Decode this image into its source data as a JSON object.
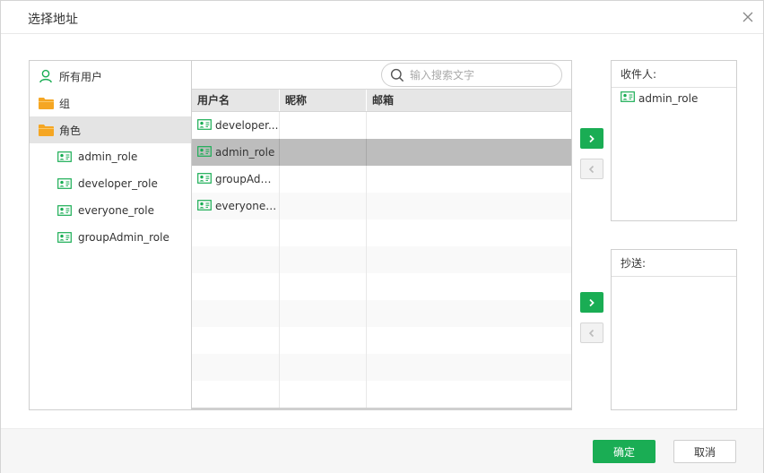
{
  "dialog": {
    "title": "选择地址"
  },
  "tree": {
    "items": [
      {
        "label": "所有用户",
        "icon": "user-icon"
      },
      {
        "label": "组",
        "icon": "folder-icon"
      },
      {
        "label": "角色",
        "icon": "folder-icon",
        "selected": true
      },
      {
        "label": "admin_role",
        "icon": "role-card-icon"
      },
      {
        "label": "developer_role",
        "icon": "role-card-icon"
      },
      {
        "label": "everyone_role",
        "icon": "role-card-icon"
      },
      {
        "label": "groupAdmin_role",
        "icon": "role-card-icon"
      }
    ]
  },
  "search": {
    "placeholder": "输入搜索文字",
    "value": ""
  },
  "grid": {
    "columns": [
      "用户名",
      "昵称",
      "邮箱"
    ],
    "rows": [
      {
        "name": "developer_role",
        "display": "developer...",
        "nickname": "",
        "email": ""
      },
      {
        "name": "admin_role",
        "display": "admin_role",
        "nickname": "",
        "email": "",
        "selected": true
      },
      {
        "name": "groupAdmin_role",
        "display": "groupAdm...",
        "nickname": "",
        "email": ""
      },
      {
        "name": "everyone_role",
        "display": "everyone_...",
        "nickname": "",
        "email": ""
      }
    ]
  },
  "recipients": {
    "to": {
      "label": "收件人:",
      "items": [
        "admin_role"
      ]
    },
    "cc": {
      "label": "抄送:",
      "items": []
    }
  },
  "footer": {
    "ok_label": "确定",
    "cancel_label": "取消"
  },
  "colors": {
    "accent": "#1aad54",
    "folder": "#f5a623",
    "selected_row": "#bdbdbd",
    "selected_tree": "#e4e4e4"
  }
}
